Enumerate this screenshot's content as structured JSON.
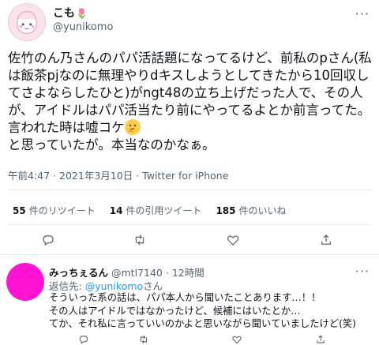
{
  "tweet": {
    "author_name": "こも",
    "author_emoji": "🌷",
    "author_handle": "@yunikomo",
    "text": "佐竹のん乃さんのパパ活話題になってるけど、前私のpさん(私は飯茶pjなのに無理やりdキスしようとしてきたから10回収してさよならしたひと)がngt48の立ち上げだった人で、その人が、アイドルはパパ活当たり前にやってるよとか前言ってた。言われた時は嘘コケ",
    "text_tail": "と思っていたが。本当なのかなぁ。",
    "time": "午前4:47",
    "date": "2021年3月10日",
    "source": "Twitter for iPhone",
    "meta_separator": "·",
    "emoji_icon": "thinking-face-icon"
  },
  "stats": {
    "retweets_count": "55",
    "retweets_label": "件のリツイート",
    "quotes_count": "14",
    "quotes_label": "件の引用ツイート",
    "likes_count": "185",
    "likes_label": "件のいいね"
  },
  "reply": {
    "name": "みっちぇるん",
    "handle": "@mtl7140",
    "time": "12時間",
    "separator": "·",
    "reply_to_label": "返信先: ",
    "reply_to_handle": "@yunikomo",
    "reply_to_suffix": "さん",
    "text": "そういった系の話は、パパ本人から聞いたことあります…！！\nその人はアイドルではなかったけど、候補にはいたとか…\nてか、それ私に言っていいのかよと思いながら聞いていましたけど(笑)"
  },
  "colors": {
    "accent": "#1d9bf0",
    "secondary_text": "#536471",
    "reply_avatar": "#ff14d4"
  }
}
